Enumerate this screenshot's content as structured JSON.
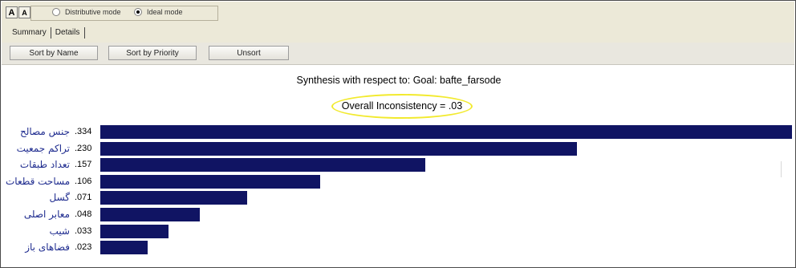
{
  "toolbar": {
    "font_up_label": "A",
    "font_down_label": "A",
    "modes": [
      {
        "label": "Distributive mode",
        "selected": false
      },
      {
        "label": "Ideal mode",
        "selected": true
      }
    ],
    "tabs": [
      "Summary",
      "Details"
    ]
  },
  "sort_buttons": {
    "by_name": "Sort by Name",
    "by_priority": "Sort by Priority",
    "unsort": "Unsort"
  },
  "synthesis": {
    "title": "Synthesis with respect to: Goal: bafte_farsode",
    "inconsistency": "Overall Inconsistency = .03",
    "highlight_color": "#f2ea2e"
  },
  "chart_data": {
    "type": "bar",
    "orientation": "horizontal",
    "bar_color": "#101463",
    "categories": [
      "جنس مصالح",
      "تراکم جمعیت",
      "تعداد طبقات",
      "مساحت قطعات",
      "گسل",
      "معابر اصلی",
      "شیب",
      "فضاهای باز"
    ],
    "values": [
      0.334,
      0.23,
      0.157,
      0.106,
      0.071,
      0.048,
      0.033,
      0.023
    ],
    "value_labels": [
      ".334",
      ".230",
      ".157",
      ".106",
      ".071",
      ".048",
      ".033",
      ".023"
    ]
  }
}
